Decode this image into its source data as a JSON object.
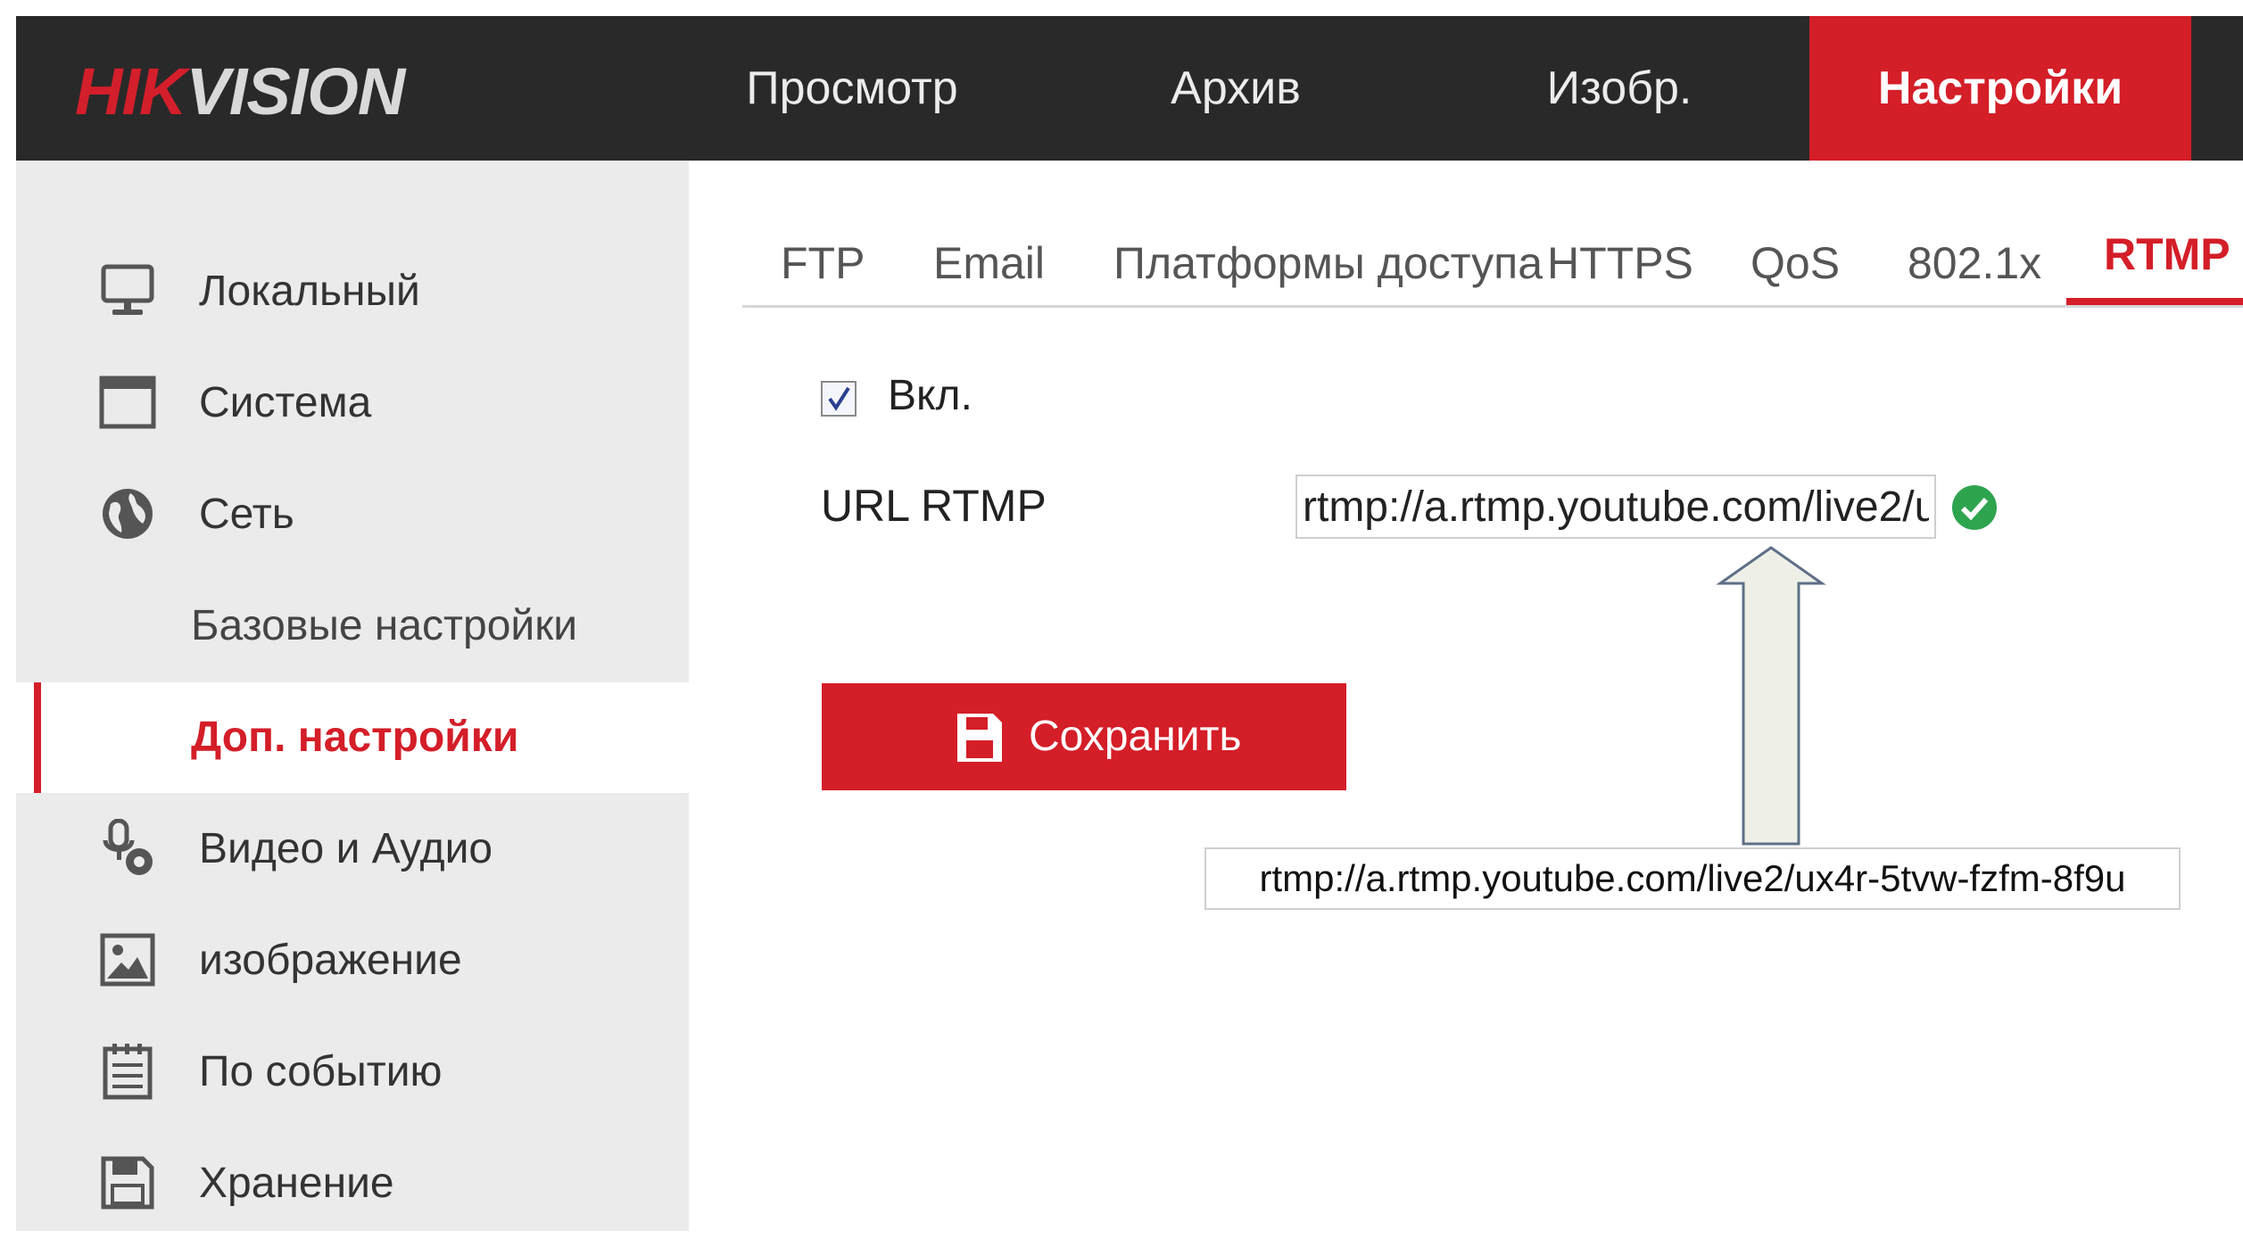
{
  "brand": {
    "logo_red": "HIK",
    "logo_gray": "VISION"
  },
  "nav": {
    "items": [
      {
        "label": "Просмотр"
      },
      {
        "label": "Архив"
      },
      {
        "label": "Изобр."
      },
      {
        "label": "Настройки",
        "active": true
      }
    ]
  },
  "sidebar": {
    "items": [
      {
        "label": "Локальный",
        "icon": "monitor-icon"
      },
      {
        "label": "Система",
        "icon": "system-window-icon"
      },
      {
        "label": "Сеть",
        "icon": "globe-icon"
      },
      {
        "label": "Базовые настройки",
        "sub": true
      },
      {
        "label": "Доп. настройки",
        "sub": true,
        "active": true
      },
      {
        "label": "Видео и Аудио",
        "icon": "microphone-camera-icon"
      },
      {
        "label": "изображение",
        "icon": "image-icon"
      },
      {
        "label": "По событию",
        "icon": "calendar-list-icon"
      },
      {
        "label": "Хранение",
        "icon": "floppy-disk-icon"
      }
    ]
  },
  "tabs": [
    {
      "label": "FTP"
    },
    {
      "label": "Email"
    },
    {
      "label": "Платформы доступа"
    },
    {
      "label": "HTTPS"
    },
    {
      "label": "QoS"
    },
    {
      "label": "802.1x"
    },
    {
      "label": "RTMP",
      "active": true
    }
  ],
  "form": {
    "enable_label": "Вкл.",
    "enable_checked": true,
    "url_label": "URL RTMP",
    "url_value": "rtmp://a.rtmp.youtube.com/live2/ux4r-5tvw-fzfm-8f9u",
    "url_status_icon": "check-circle-icon",
    "save_label": "Сохранить"
  },
  "annotation": {
    "callout_text": "rtmp://a.rtmp.youtube.com/live2/ux4r-5tvw-fzfm-8f9u"
  },
  "colors": {
    "accent": "#d41e28",
    "topbar": "#292929",
    "sidebar": "#ebebeb",
    "ok_green": "#2ea44f"
  }
}
